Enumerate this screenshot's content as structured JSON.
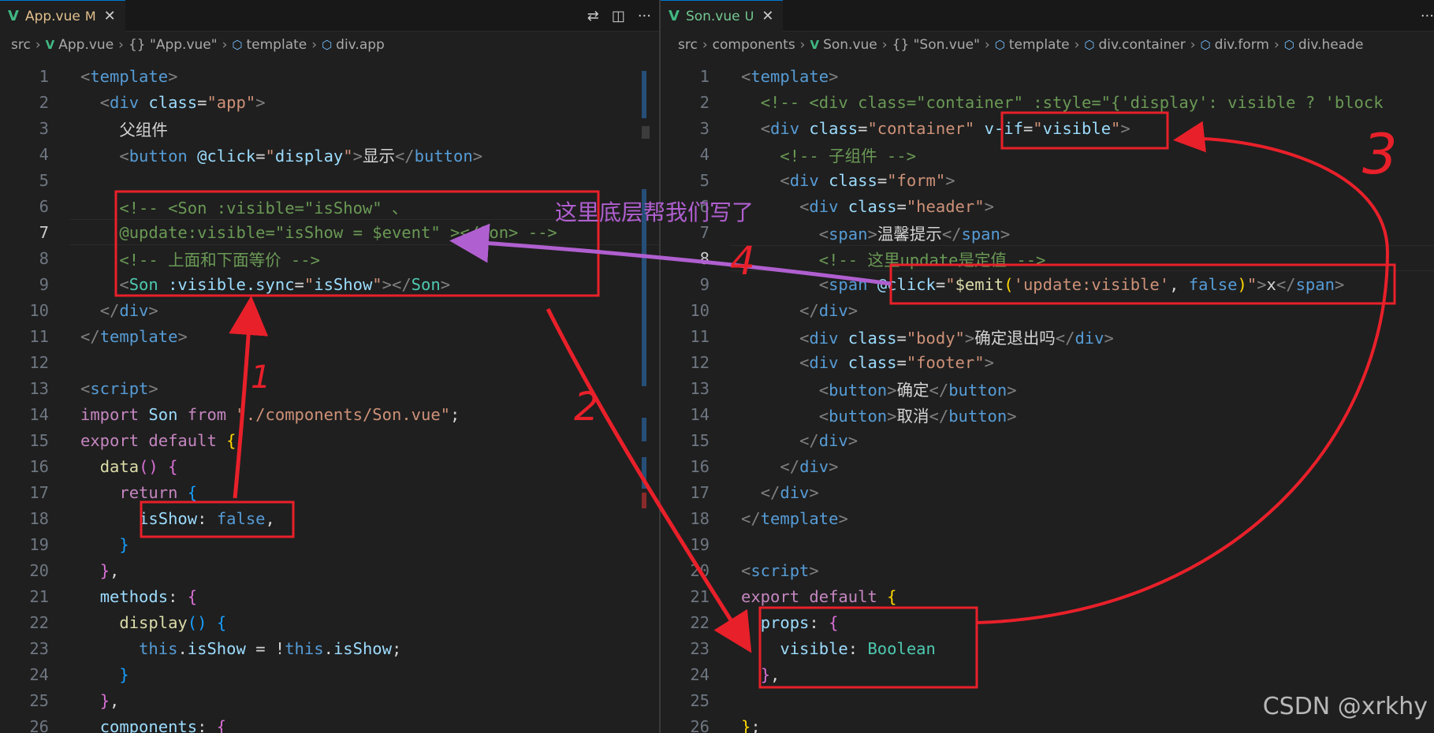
{
  "left": {
    "tab": {
      "icon": "vue-logo-icon",
      "name": "App.vue",
      "status": "M",
      "close": "✕"
    },
    "actions": [
      "⇄",
      "◫",
      "···"
    ],
    "breadcrumb": [
      "src",
      "App.vue",
      "{} \"App.vue\"",
      "template",
      "div.app"
    ],
    "lines": [
      {
        "n": "1",
        "html": "<span class='k-punct'>&lt;</span><span class='k-tag'>template</span><span class='k-punct'>&gt;</span>"
      },
      {
        "n": "2",
        "html": "  <span class='k-punct'>&lt;</span><span class='k-tag'>div</span> <span class='k-attr'>class</span><span class='k-text'>=</span><span class='k-str'>\"app\"</span><span class='k-punct'>&gt;</span>"
      },
      {
        "n": "3",
        "html": "    <span class='k-text'>父组件</span>"
      },
      {
        "n": "4",
        "html": "    <span class='k-punct'>&lt;</span><span class='k-tag'>button</span> <span class='k-attr'>@click</span><span class='k-text'>=</span><span class='k-str'>\"</span><span class='k-attr'>display</span><span class='k-str'>\"</span><span class='k-punct'>&gt;</span><span class='k-text'>显示</span><span class='k-punct'>&lt;/</span><span class='k-tag'>button</span><span class='k-punct'>&gt;</span>"
      },
      {
        "n": "5",
        "html": ""
      },
      {
        "n": "6",
        "html": "    <span class='k-comment'>&lt;!-- &lt;Son :visible=\"isShow\" 、</span>"
      },
      {
        "n": "7",
        "html": "    <span class='k-comment'>@update:visible=\"isShow = $event\" &gt;&lt;/Son&gt; --&gt;</span>"
      },
      {
        "n": "8",
        "html": "    <span class='k-comment'>&lt;!-- 上面和下面等价 --&gt;</span>"
      },
      {
        "n": "9",
        "html": "    <span class='k-punct'>&lt;</span><span class='k-type'>Son</span> <span class='k-attr'>:visible.sync</span><span class='k-text'>=</span><span class='k-str'>\"</span><span class='k-attr'>isShow</span><span class='k-str'>\"</span><span class='k-punct'>&gt;&lt;/</span><span class='k-type'>Son</span><span class='k-punct'>&gt;</span>"
      },
      {
        "n": "10",
        "html": "  <span class='k-punct'>&lt;/</span><span class='k-tag'>div</span><span class='k-punct'>&gt;</span>"
      },
      {
        "n": "11",
        "html": "<span class='k-punct'>&lt;/</span><span class='k-tag'>template</span><span class='k-punct'>&gt;</span>"
      },
      {
        "n": "12",
        "html": ""
      },
      {
        "n": "13",
        "html": "<span class='k-punct'>&lt;</span><span class='k-tag'>script</span><span class='k-punct'>&gt;</span>"
      },
      {
        "n": "14",
        "html": "<span class='k-kw'>import</span> <span class='k-attr'>Son</span> <span class='k-kw'>from</span> <span class='k-str'>\"./components/Son.vue\"</span><span class='k-text'>;</span>"
      },
      {
        "n": "15",
        "html": "<span class='k-kw'>export</span> <span class='k-kw'>default</span> <span class='k-brace1'>{</span>"
      },
      {
        "n": "16",
        "html": "  <span class='k-fn'>data</span><span class='k-brace2'>()</span> <span class='k-brace2'>{</span>"
      },
      {
        "n": "17",
        "html": "    <span class='k-kw'>return</span> <span class='k-brace3'>{</span>"
      },
      {
        "n": "18",
        "html": "      <span class='k-attr'>isShow</span><span class='k-text'>:</span> <span class='k-blue'>false</span><span class='k-text'>,</span>"
      },
      {
        "n": "19",
        "html": "    <span class='k-brace3'>}</span>"
      },
      {
        "n": "20",
        "html": "  <span class='k-brace2'>}</span><span class='k-text'>,</span>"
      },
      {
        "n": "21",
        "html": "  <span class='k-attr'>methods</span><span class='k-text'>:</span> <span class='k-brace2'>{</span>"
      },
      {
        "n": "22",
        "html": "    <span class='k-fn'>display</span><span class='k-brace3'>()</span> <span class='k-brace3'>{</span>"
      },
      {
        "n": "23",
        "html": "      <span class='k-blue'>this</span><span class='k-text'>.</span><span class='k-attr'>isShow</span> <span class='k-text'>= !</span><span class='k-blue'>this</span><span class='k-text'>.</span><span class='k-attr'>isShow</span><span class='k-text'>;</span>"
      },
      {
        "n": "24",
        "html": "    <span class='k-brace3'>}</span>"
      },
      {
        "n": "25",
        "html": "  <span class='k-brace2'>}</span><span class='k-text'>,</span>"
      },
      {
        "n": "26",
        "html": "  <span class='k-attr'>components</span><span class='k-text'>:</span> <span class='k-brace2'>{</span>"
      }
    ]
  },
  "right": {
    "tab": {
      "icon": "vue-logo-icon",
      "name": "Son.vue",
      "status": "U",
      "close": "✕"
    },
    "actions": [
      "···"
    ],
    "breadcrumb": [
      "src",
      "components",
      "Son.vue",
      "{} \"Son.vue\"",
      "template",
      "div.container",
      "div.form",
      "div.heade"
    ],
    "lines": [
      {
        "n": "1",
        "html": "<span class='k-punct'>&lt;</span><span class='k-tag'>template</span><span class='k-punct'>&gt;</span>"
      },
      {
        "n": "2",
        "html": "  <span class='k-comment'>&lt;!-- &lt;div class=\"container\" :style=\"{'display': visible ? 'block</span>"
      },
      {
        "n": "3",
        "html": "  <span class='k-punct'>&lt;</span><span class='k-tag'>div</span> <span class='k-attr'>class</span><span class='k-text'>=</span><span class='k-str'>\"container\"</span> <span class='k-attr'>v-if</span><span class='k-text'>=</span><span class='k-str'>\"</span><span class='k-attr'>visible</span><span class='k-str'>\"</span><span class='k-punct'>&gt;</span>"
      },
      {
        "n": "4",
        "html": "    <span class='k-comment'>&lt;!-- 子组件 --&gt;</span>"
      },
      {
        "n": "5",
        "html": "    <span class='k-punct'>&lt;</span><span class='k-tag'>div</span> <span class='k-attr'>class</span><span class='k-text'>=</span><span class='k-str'>\"form\"</span><span class='k-punct'>&gt;</span>"
      },
      {
        "n": "6",
        "html": "      <span class='k-punct'>&lt;</span><span class='k-tag'>div</span> <span class='k-attr'>class</span><span class='k-text'>=</span><span class='k-str'>\"header\"</span><span class='k-punct'>&gt;</span>"
      },
      {
        "n": "7",
        "html": "        <span class='k-punct'>&lt;</span><span class='k-tag'>span</span><span class='k-punct'>&gt;</span><span class='k-text'>温馨提示</span><span class='k-punct'>&lt;/</span><span class='k-tag'>span</span><span class='k-punct'>&gt;</span>"
      },
      {
        "n": "8",
        "html": "        <span class='k-comment'>&lt;!-- 这里update是定值 --&gt;</span>"
      },
      {
        "n": "9",
        "html": "        <span class='k-punct'>&lt;</span><span class='k-tag'>span</span> <span class='k-attr'>@click</span><span class='k-text'>=</span><span class='k-str'>\"</span><span class='k-fn'>$emit</span><span class='k-brace1'>(</span><span class='k-str'>'update:visible'</span><span class='k-text'>, </span><span class='k-blue'>false</span><span class='k-brace1'>)</span><span class='k-str'>\"</span><span class='k-punct'>&gt;</span><span class='k-text'>x</span><span class='k-punct'>&lt;/</span><span class='k-tag'>span</span><span class='k-punct'>&gt;</span>"
      },
      {
        "n": "10",
        "html": "      <span class='k-punct'>&lt;/</span><span class='k-tag'>div</span><span class='k-punct'>&gt;</span>"
      },
      {
        "n": "11",
        "html": "      <span class='k-punct'>&lt;</span><span class='k-tag'>div</span> <span class='k-attr'>class</span><span class='k-text'>=</span><span class='k-str'>\"body\"</span><span class='k-punct'>&gt;</span><span class='k-text'>确定退出吗</span><span class='k-punct'>&lt;/</span><span class='k-tag'>div</span><span class='k-punct'>&gt;</span>"
      },
      {
        "n": "12",
        "html": "      <span class='k-punct'>&lt;</span><span class='k-tag'>div</span> <span class='k-attr'>class</span><span class='k-text'>=</span><span class='k-str'>\"footer\"</span><span class='k-punct'>&gt;</span>"
      },
      {
        "n": "13",
        "html": "        <span class='k-punct'>&lt;</span><span class='k-tag'>button</span><span class='k-punct'>&gt;</span><span class='k-text'>确定</span><span class='k-punct'>&lt;/</span><span class='k-tag'>button</span><span class='k-punct'>&gt;</span>"
      },
      {
        "n": "14",
        "html": "        <span class='k-punct'>&lt;</span><span class='k-tag'>button</span><span class='k-punct'>&gt;</span><span class='k-text'>取消</span><span class='k-punct'>&lt;/</span><span class='k-tag'>button</span><span class='k-punct'>&gt;</span>"
      },
      {
        "n": "15",
        "html": "      <span class='k-punct'>&lt;/</span><span class='k-tag'>div</span><span class='k-punct'>&gt;</span>"
      },
      {
        "n": "16",
        "html": "    <span class='k-punct'>&lt;/</span><span class='k-tag'>div</span><span class='k-punct'>&gt;</span>"
      },
      {
        "n": "17",
        "html": "  <span class='k-punct'>&lt;/</span><span class='k-tag'>div</span><span class='k-punct'>&gt;</span>"
      },
      {
        "n": "18",
        "html": "<span class='k-punct'>&lt;/</span><span class='k-tag'>template</span><span class='k-punct'>&gt;</span>"
      },
      {
        "n": "19",
        "html": ""
      },
      {
        "n": "20",
        "html": "<span class='k-punct'>&lt;</span><span class='k-tag'>script</span><span class='k-punct'>&gt;</span>"
      },
      {
        "n": "21",
        "html": "<span class='k-kw'>export</span> <span class='k-kw'>default</span> <span class='k-brace1'>{</span>"
      },
      {
        "n": "22",
        "html": "  <span class='k-attr'>props</span><span class='k-text'>:</span> <span class='k-brace2'>{</span>"
      },
      {
        "n": "23",
        "html": "    <span class='k-attr'>visible</span><span class='k-text'>:</span> <span class='k-type'>Boolean</span>"
      },
      {
        "n": "24",
        "html": "  <span class='k-brace2'>}</span><span class='k-text'>,</span>"
      },
      {
        "n": "25",
        "html": ""
      },
      {
        "n": "26",
        "html": "<span class='k-brace1'>}</span><span class='k-text'>;</span>"
      }
    ]
  },
  "annotations": {
    "note": "这里底层帮我们写了",
    "numbers": [
      "1",
      "2",
      "3",
      "4"
    ],
    "box_color": "#e8202a",
    "arrow_color": "#e8202a",
    "note_color": "#b05fd0"
  },
  "watermark": "CSDN @xrkhy"
}
